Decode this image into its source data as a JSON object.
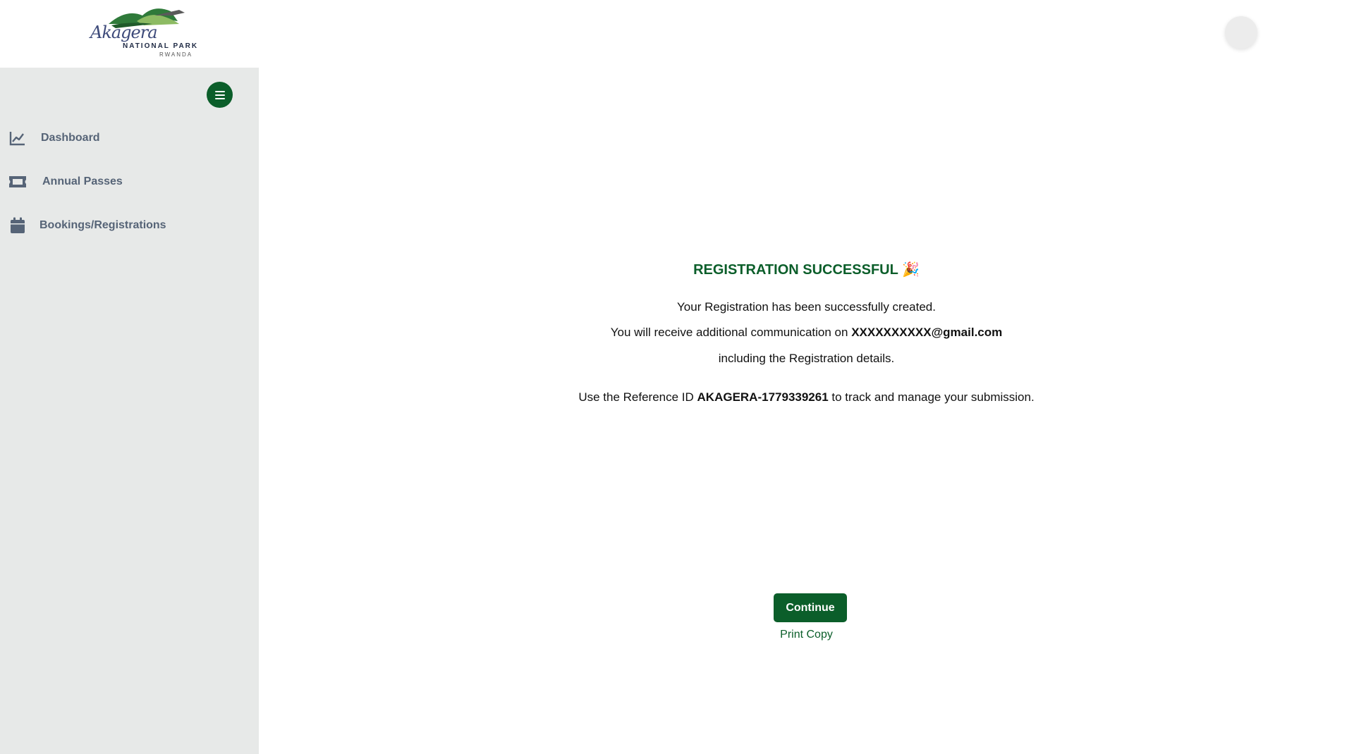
{
  "header": {
    "logo": {
      "script": "Akagera",
      "line1": "NATIONAL PARK",
      "line2": "RWANDA"
    }
  },
  "sidebar": {
    "items": [
      {
        "label": "Dashboard",
        "icon": "chart-line-icon"
      },
      {
        "label": "Annual Passes",
        "icon": "ticket-icon"
      },
      {
        "label": "Bookings/Registrations",
        "icon": "calendar-icon"
      }
    ]
  },
  "confirmation": {
    "title": "REGISTRATION SUCCESSFUL",
    "title_emoji": "🎉",
    "line1": "Your Registration has been successfully created.",
    "line2_prefix": "You will receive additional communication on",
    "email": "XXXXXXXXXX@gmail.com",
    "line3": "including the Registration details.",
    "ref_prefix": "Use the Reference ID",
    "reference_id": "AKAGERA-1779339261",
    "ref_suffix": "to track and manage your submission."
  },
  "actions": {
    "continue_label": "Continue",
    "print_label": "Print Copy"
  },
  "colors": {
    "brand_green": "#0b5e2a",
    "sidebar_bg": "#e7e9e8",
    "nav_text": "#566477"
  }
}
